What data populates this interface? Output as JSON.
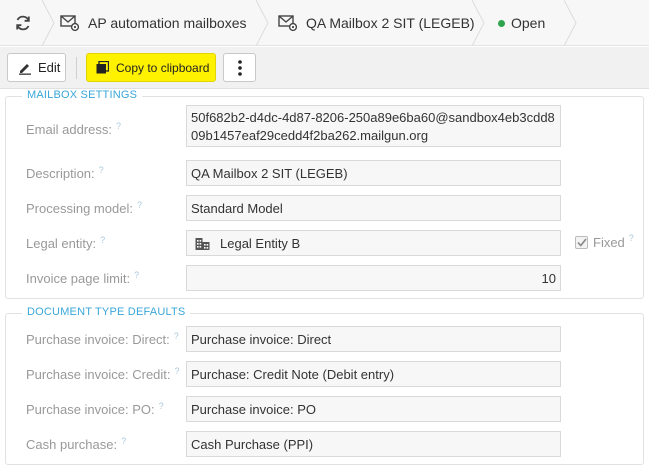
{
  "breadcrumbs": {
    "refresh_icon": "refresh-icon",
    "items": [
      {
        "label": "AP automation mailboxes",
        "icon": "mail-settings-icon"
      },
      {
        "label": "QA Mailbox 2 SIT (LEGEB)",
        "icon": "mail-settings-icon"
      },
      {
        "label": "Open",
        "status_color": "#2ea44f"
      }
    ]
  },
  "toolbar": {
    "edit_label": "Edit",
    "copy_label": "Copy to clipboard",
    "copy_highlight_color": "#fff200",
    "more_icon": "kebab-menu-icon"
  },
  "mailbox_settings": {
    "legend": "MAILBOX SETTINGS",
    "email": {
      "label": "Email address:",
      "value_line1": "50f682b2-d4dc-4d87-8206-250a89e6ba60@sandbox4eb3cdd8",
      "value_line2": "09b1457eaf29cedd4f2ba262.mailgun.org"
    },
    "description": {
      "label": "Description:",
      "value": "QA Mailbox 2 SIT (LEGEB)"
    },
    "processing_model": {
      "label": "Processing model:",
      "value": "Standard Model"
    },
    "legal_entity": {
      "label": "Legal entity:",
      "value": "Legal Entity B",
      "icon": "building-icon",
      "fixed_label": "Fixed",
      "fixed_checked": true
    },
    "invoice_page_limit": {
      "label": "Invoice page limit:",
      "value": "10"
    },
    "help_mark": "?"
  },
  "document_type_defaults": {
    "legend": "DOCUMENT TYPE DEFAULTS",
    "rows": [
      {
        "label": "Purchase invoice: Direct:",
        "value": "Purchase invoice: Direct"
      },
      {
        "label": "Purchase invoice: Credit:",
        "value": "Purchase: Credit Note (Debit entry)"
      },
      {
        "label": "Purchase invoice: PO:",
        "value": "Purchase invoice: PO"
      },
      {
        "label": "Cash purchase:",
        "value": "Cash Purchase (PPI)"
      }
    ]
  }
}
